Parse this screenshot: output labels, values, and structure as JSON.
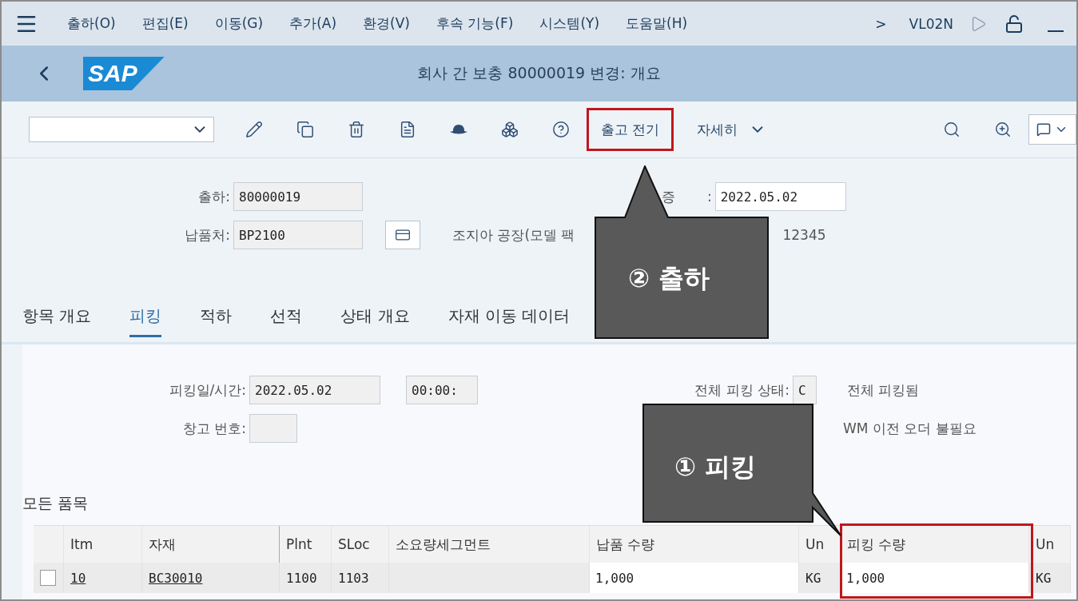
{
  "menu_bar": {
    "items": [
      "출하(O)",
      "편집(E)",
      "이동(G)",
      "추가(A)",
      "환경(V)",
      "후속 기능(F)",
      "시스템(Y)",
      "도움말(H)"
    ],
    "more": ">",
    "transaction": "VL02N"
  },
  "title_bar": {
    "logo": "SAP",
    "title": "회사 간 보충 80000019 변경: 개요"
  },
  "toolbar": {
    "post_button": "출고 전기",
    "more_button": "자세히",
    "highlighted": true
  },
  "header": {
    "delivery_label": "출하:",
    "delivery_value": "80000019",
    "date_label_start": "증",
    "date_label_end": ":",
    "date_value": "2022.05.02",
    "ship_to_label": "납품처:",
    "ship_to_value": "BP2100",
    "address_start": "조지아 공장(모델 팩",
    "address_end": "12345"
  },
  "tabs": [
    {
      "label": "항목 개요",
      "selected": false
    },
    {
      "label": "피킹",
      "selected": true
    },
    {
      "label": "적하",
      "selected": false
    },
    {
      "label": "선적",
      "selected": false
    },
    {
      "label": "상태 개요",
      "selected": false
    },
    {
      "label": "자재 이동 데이터",
      "selected": false
    }
  ],
  "picking": {
    "date_label": "피킹일/시간:",
    "date_value": "2022.05.02",
    "time_value": "00:00:",
    "warehouse_label": "창고 번호:",
    "status_label": "전체 피킹 상태:",
    "status_value": "C",
    "status_text": "전체 피킹됨",
    "wm_text": "WM 이전 오더 불필요"
  },
  "table": {
    "title": "모든 품목",
    "columns": [
      "Itm",
      "자재",
      "Plnt",
      "SLoc",
      "소요량세그먼트",
      "납품 수량",
      "Un",
      "피킹 수량",
      "Un"
    ],
    "rows": [
      {
        "selected": false,
        "cells": [
          "10",
          "BC30010",
          "1100",
          "1103",
          "",
          "1,000",
          "KG",
          "1,000",
          "KG"
        ]
      }
    ]
  },
  "callouts": [
    {
      "text": "② 출하"
    },
    {
      "text": "① 피킹"
    }
  ]
}
